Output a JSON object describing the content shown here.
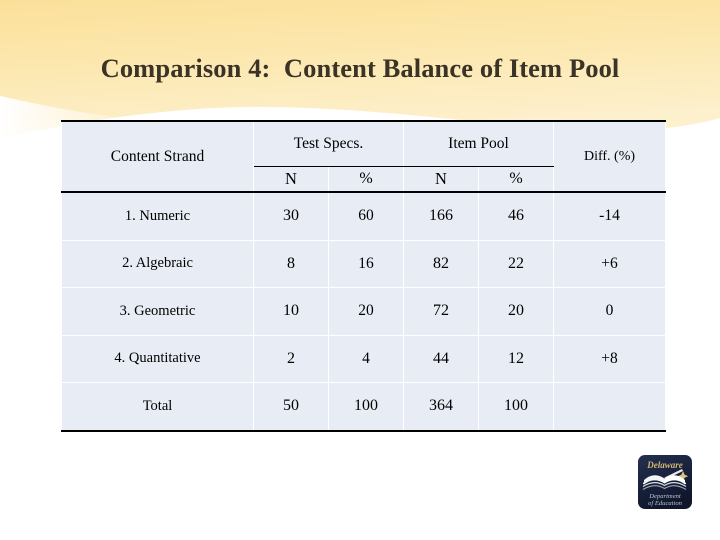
{
  "slide": {
    "title": "Comparison 4:  Content Balance of Item Pool",
    "background_top_color": "#fbe4a0",
    "background_base_color": "#ffffff"
  },
  "table": {
    "header": {
      "strand_label": "Content Strand",
      "group_test_specs": "Test Specs.",
      "group_item_pool": "Item Pool",
      "diff_label": "Diff. (%)",
      "sub_n_1": "N",
      "sub_pct_1": "%",
      "sub_n_2": "N",
      "sub_pct_2": "%"
    },
    "colors": {
      "cell_background": "#e8ecf4",
      "percent_green": "#1a7a56",
      "diff_red": "#b02028",
      "rule_black": "#000000"
    },
    "rows": [
      {
        "strand": "1. Numeric",
        "spec_n": "30",
        "spec_pct": "60",
        "pool_n": "166",
        "pool_pct": "46",
        "diff": "-14"
      },
      {
        "strand": "2. Algebraic",
        "spec_n": "8",
        "spec_pct": "16",
        "pool_n": "82",
        "pool_pct": "22",
        "diff": "+6"
      },
      {
        "strand": "3. Geometric",
        "spec_n": "10",
        "spec_pct": "20",
        "pool_n": "72",
        "pool_pct": "20",
        "diff": "0"
      },
      {
        "strand": "4. Quantitative",
        "spec_n": "2",
        "spec_pct": "4",
        "pool_n": "44",
        "pool_pct": "12",
        "diff": "+8"
      }
    ],
    "total_row": {
      "strand": "Total",
      "spec_n": "50",
      "spec_pct": "100",
      "pool_n": "364",
      "pool_pct": "100",
      "diff": ""
    }
  },
  "logo": {
    "name": "delaware-department-of-education-logo",
    "script_text": "Delaware",
    "line1": "Department",
    "line2": "of Education",
    "background_color": "#16203c",
    "script_color": "#e2c77a"
  }
}
